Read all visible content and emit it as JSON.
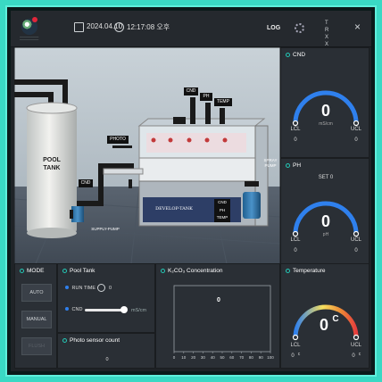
{
  "header": {
    "date": "2024.04.10",
    "time": "12:17:08 오후",
    "log_label": "LOG",
    "trx": "T R X X",
    "close": "×"
  },
  "scene": {
    "pool_tank": "POOL TANK",
    "supply_pump": "SUPPLY-PUMP",
    "cnd_tag": "CND",
    "photo_tag": "PHOTO",
    "cnd_top": "CND",
    "ph_top": "PH",
    "temp_top": "TEMP",
    "spray_pump": "SPRAY PUMP",
    "develop_tank": "DEVELOP-TANK",
    "tank_cnd": "CND",
    "tank_ph": "PH",
    "tank_temp": "TEMP"
  },
  "cnd_gauge": {
    "title": "CND",
    "value": "0",
    "unit": "mS/cm",
    "lcl_label": "LCL",
    "ucl_label": "UCL",
    "lcl": "0",
    "ucl": "0"
  },
  "ph_gauge": {
    "title": "PH",
    "set_label": "SET 0",
    "value": "0",
    "unit": "pH",
    "lcl_label": "LCL",
    "ucl_label": "UCL",
    "lcl": "0",
    "ucl": "0"
  },
  "temp_gauge": {
    "title": "Temperature",
    "value": "0",
    "unit": "C",
    "lcl_label": "LCL",
    "ucl_label": "UCL",
    "lcl": "0",
    "ucl": "0",
    "lcl_unit": "c",
    "ucl_unit": "c"
  },
  "mode": {
    "title": "MODE",
    "auto": "AUTO",
    "manual": "MANUAL",
    "flush": "FLUSH"
  },
  "pool": {
    "title": "Pool Tank",
    "run_time_label": "RUN TIME",
    "run_time_value": "0",
    "cnd_label": "CND",
    "cnd_unit": "mS/cm",
    "cnd_value": "0"
  },
  "photo": {
    "title": "Photo sensor count",
    "value": "0"
  },
  "k2co3": {
    "title": "K₂CO₃ Concentration",
    "value": "0"
  },
  "chart_data": {
    "type": "line",
    "title": "K₂CO₃ Concentration",
    "x_ticks": [
      "0",
      "10",
      "20",
      "30",
      "40",
      "50",
      "60",
      "70",
      "80",
      "90",
      "100"
    ],
    "xlim": [
      0,
      100
    ],
    "series": [],
    "grid": true,
    "value_display": "0"
  },
  "colors": {
    "accent": "#24c8b6",
    "panel": "#2a2f35",
    "bg": "#1f2327",
    "gauge_blue": "#2f80ed",
    "frame": "#3ad9c4"
  }
}
